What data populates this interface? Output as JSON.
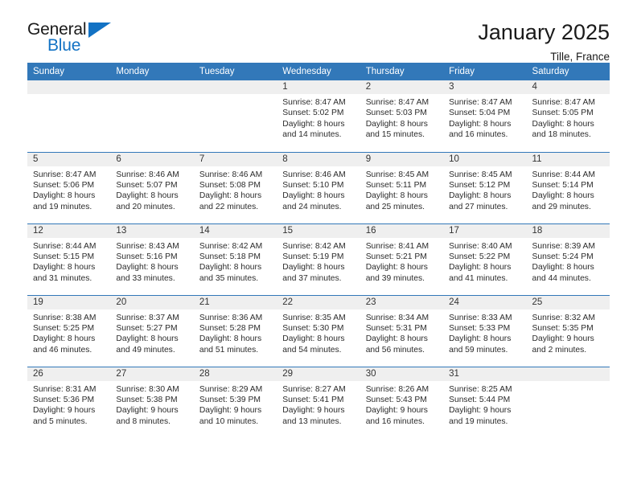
{
  "brand": {
    "name_top": "General",
    "name_bottom": "Blue",
    "accent_color": "#1272c4"
  },
  "header": {
    "title": "January 2025",
    "location": "Tille, France"
  },
  "calendar": {
    "header_bg": "#3278b9",
    "daynum_bg": "#efefef",
    "weekday_headers": [
      "Sunday",
      "Monday",
      "Tuesday",
      "Wednesday",
      "Thursday",
      "Friday",
      "Saturday"
    ],
    "weeks": [
      [
        {
          "day": "",
          "sunrise": "",
          "sunset": "",
          "daylight_line1": "",
          "daylight_line2": "",
          "empty": true
        },
        {
          "day": "",
          "sunrise": "",
          "sunset": "",
          "daylight_line1": "",
          "daylight_line2": "",
          "empty": true
        },
        {
          "day": "",
          "sunrise": "",
          "sunset": "",
          "daylight_line1": "",
          "daylight_line2": "",
          "empty": true
        },
        {
          "day": "1",
          "sunrise": "Sunrise: 8:47 AM",
          "sunset": "Sunset: 5:02 PM",
          "daylight_line1": "Daylight: 8 hours",
          "daylight_line2": "and 14 minutes."
        },
        {
          "day": "2",
          "sunrise": "Sunrise: 8:47 AM",
          "sunset": "Sunset: 5:03 PM",
          "daylight_line1": "Daylight: 8 hours",
          "daylight_line2": "and 15 minutes."
        },
        {
          "day": "3",
          "sunrise": "Sunrise: 8:47 AM",
          "sunset": "Sunset: 5:04 PM",
          "daylight_line1": "Daylight: 8 hours",
          "daylight_line2": "and 16 minutes."
        },
        {
          "day": "4",
          "sunrise": "Sunrise: 8:47 AM",
          "sunset": "Sunset: 5:05 PM",
          "daylight_line1": "Daylight: 8 hours",
          "daylight_line2": "and 18 minutes."
        }
      ],
      [
        {
          "day": "5",
          "sunrise": "Sunrise: 8:47 AM",
          "sunset": "Sunset: 5:06 PM",
          "daylight_line1": "Daylight: 8 hours",
          "daylight_line2": "and 19 minutes."
        },
        {
          "day": "6",
          "sunrise": "Sunrise: 8:46 AM",
          "sunset": "Sunset: 5:07 PM",
          "daylight_line1": "Daylight: 8 hours",
          "daylight_line2": "and 20 minutes."
        },
        {
          "day": "7",
          "sunrise": "Sunrise: 8:46 AM",
          "sunset": "Sunset: 5:08 PM",
          "daylight_line1": "Daylight: 8 hours",
          "daylight_line2": "and 22 minutes."
        },
        {
          "day": "8",
          "sunrise": "Sunrise: 8:46 AM",
          "sunset": "Sunset: 5:10 PM",
          "daylight_line1": "Daylight: 8 hours",
          "daylight_line2": "and 24 minutes."
        },
        {
          "day": "9",
          "sunrise": "Sunrise: 8:45 AM",
          "sunset": "Sunset: 5:11 PM",
          "daylight_line1": "Daylight: 8 hours",
          "daylight_line2": "and 25 minutes."
        },
        {
          "day": "10",
          "sunrise": "Sunrise: 8:45 AM",
          "sunset": "Sunset: 5:12 PM",
          "daylight_line1": "Daylight: 8 hours",
          "daylight_line2": "and 27 minutes."
        },
        {
          "day": "11",
          "sunrise": "Sunrise: 8:44 AM",
          "sunset": "Sunset: 5:14 PM",
          "daylight_line1": "Daylight: 8 hours",
          "daylight_line2": "and 29 minutes."
        }
      ],
      [
        {
          "day": "12",
          "sunrise": "Sunrise: 8:44 AM",
          "sunset": "Sunset: 5:15 PM",
          "daylight_line1": "Daylight: 8 hours",
          "daylight_line2": "and 31 minutes."
        },
        {
          "day": "13",
          "sunrise": "Sunrise: 8:43 AM",
          "sunset": "Sunset: 5:16 PM",
          "daylight_line1": "Daylight: 8 hours",
          "daylight_line2": "and 33 minutes."
        },
        {
          "day": "14",
          "sunrise": "Sunrise: 8:42 AM",
          "sunset": "Sunset: 5:18 PM",
          "daylight_line1": "Daylight: 8 hours",
          "daylight_line2": "and 35 minutes."
        },
        {
          "day": "15",
          "sunrise": "Sunrise: 8:42 AM",
          "sunset": "Sunset: 5:19 PM",
          "daylight_line1": "Daylight: 8 hours",
          "daylight_line2": "and 37 minutes."
        },
        {
          "day": "16",
          "sunrise": "Sunrise: 8:41 AM",
          "sunset": "Sunset: 5:21 PM",
          "daylight_line1": "Daylight: 8 hours",
          "daylight_line2": "and 39 minutes."
        },
        {
          "day": "17",
          "sunrise": "Sunrise: 8:40 AM",
          "sunset": "Sunset: 5:22 PM",
          "daylight_line1": "Daylight: 8 hours",
          "daylight_line2": "and 41 minutes."
        },
        {
          "day": "18",
          "sunrise": "Sunrise: 8:39 AM",
          "sunset": "Sunset: 5:24 PM",
          "daylight_line1": "Daylight: 8 hours",
          "daylight_line2": "and 44 minutes."
        }
      ],
      [
        {
          "day": "19",
          "sunrise": "Sunrise: 8:38 AM",
          "sunset": "Sunset: 5:25 PM",
          "daylight_line1": "Daylight: 8 hours",
          "daylight_line2": "and 46 minutes."
        },
        {
          "day": "20",
          "sunrise": "Sunrise: 8:37 AM",
          "sunset": "Sunset: 5:27 PM",
          "daylight_line1": "Daylight: 8 hours",
          "daylight_line2": "and 49 minutes."
        },
        {
          "day": "21",
          "sunrise": "Sunrise: 8:36 AM",
          "sunset": "Sunset: 5:28 PM",
          "daylight_line1": "Daylight: 8 hours",
          "daylight_line2": "and 51 minutes."
        },
        {
          "day": "22",
          "sunrise": "Sunrise: 8:35 AM",
          "sunset": "Sunset: 5:30 PM",
          "daylight_line1": "Daylight: 8 hours",
          "daylight_line2": "and 54 minutes."
        },
        {
          "day": "23",
          "sunrise": "Sunrise: 8:34 AM",
          "sunset": "Sunset: 5:31 PM",
          "daylight_line1": "Daylight: 8 hours",
          "daylight_line2": "and 56 minutes."
        },
        {
          "day": "24",
          "sunrise": "Sunrise: 8:33 AM",
          "sunset": "Sunset: 5:33 PM",
          "daylight_line1": "Daylight: 8 hours",
          "daylight_line2": "and 59 minutes."
        },
        {
          "day": "25",
          "sunrise": "Sunrise: 8:32 AM",
          "sunset": "Sunset: 5:35 PM",
          "daylight_line1": "Daylight: 9 hours",
          "daylight_line2": "and 2 minutes."
        }
      ],
      [
        {
          "day": "26",
          "sunrise": "Sunrise: 8:31 AM",
          "sunset": "Sunset: 5:36 PM",
          "daylight_line1": "Daylight: 9 hours",
          "daylight_line2": "and 5 minutes."
        },
        {
          "day": "27",
          "sunrise": "Sunrise: 8:30 AM",
          "sunset": "Sunset: 5:38 PM",
          "daylight_line1": "Daylight: 9 hours",
          "daylight_line2": "and 8 minutes."
        },
        {
          "day": "28",
          "sunrise": "Sunrise: 8:29 AM",
          "sunset": "Sunset: 5:39 PM",
          "daylight_line1": "Daylight: 9 hours",
          "daylight_line2": "and 10 minutes."
        },
        {
          "day": "29",
          "sunrise": "Sunrise: 8:27 AM",
          "sunset": "Sunset: 5:41 PM",
          "daylight_line1": "Daylight: 9 hours",
          "daylight_line2": "and 13 minutes."
        },
        {
          "day": "30",
          "sunrise": "Sunrise: 8:26 AM",
          "sunset": "Sunset: 5:43 PM",
          "daylight_line1": "Daylight: 9 hours",
          "daylight_line2": "and 16 minutes."
        },
        {
          "day": "31",
          "sunrise": "Sunrise: 8:25 AM",
          "sunset": "Sunset: 5:44 PM",
          "daylight_line1": "Daylight: 9 hours",
          "daylight_line2": "and 19 minutes."
        },
        {
          "day": "",
          "sunrise": "",
          "sunset": "",
          "daylight_line1": "",
          "daylight_line2": "",
          "empty": true
        }
      ]
    ]
  }
}
